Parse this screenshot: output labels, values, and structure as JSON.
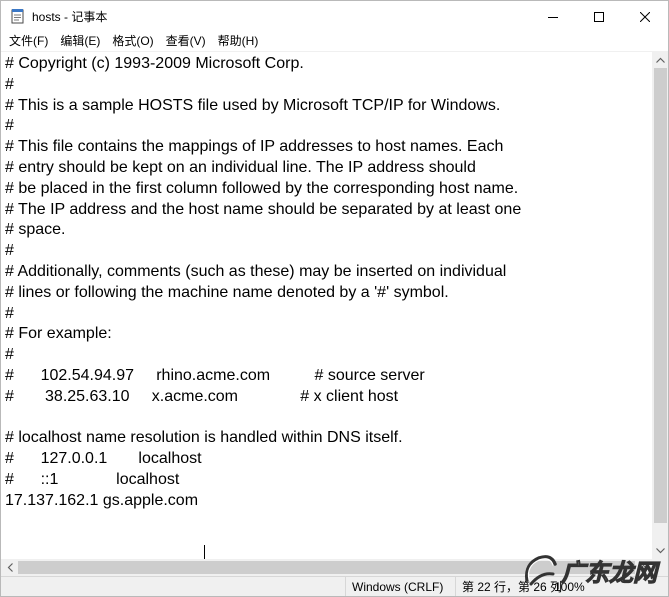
{
  "window": {
    "title": "hosts - 记事本"
  },
  "menu": [
    {
      "label": "文件(F)"
    },
    {
      "label": "编辑(E)"
    },
    {
      "label": "格式(O)"
    },
    {
      "label": "查看(V)"
    },
    {
      "label": "帮助(H)"
    }
  ],
  "editor": {
    "text": "# Copyright (c) 1993-2009 Microsoft Corp.\n#\n# This is a sample HOSTS file used by Microsoft TCP/IP for Windows.\n#\n# This file contains the mappings of IP addresses to host names. Each\n# entry should be kept on an individual line. The IP address should\n# be placed in the first column followed by the corresponding host name.\n# The IP address and the host name should be separated by at least one\n# space.\n#\n# Additionally, comments (such as these) may be inserted on individual\n# lines or following the machine name denoted by a '#' symbol.\n#\n# For example:\n#\n#      102.54.94.97     rhino.acme.com          # source server\n#       38.25.63.10     x.acme.com              # x client host\n\n# localhost name resolution is handled within DNS itself.\n#\t127.0.0.1       localhost\n#\t::1             localhost\n17.137.162.1 gs.apple.com"
  },
  "statusbar": {
    "encoding": "Windows (CRLF)",
    "position": "第 22 行，第 26 列",
    "zoom": "100%"
  },
  "watermark": {
    "text": "广东龙网"
  },
  "colors": {
    "scrollbar_track": "#f0f0f0",
    "scrollbar_thumb": "#cdcdcd",
    "statusbar_bg": "#f0f0f0"
  },
  "icons": {
    "app": "notepad-icon",
    "minimize": "minimize-icon",
    "maximize": "maximize-icon",
    "close": "close-icon"
  }
}
